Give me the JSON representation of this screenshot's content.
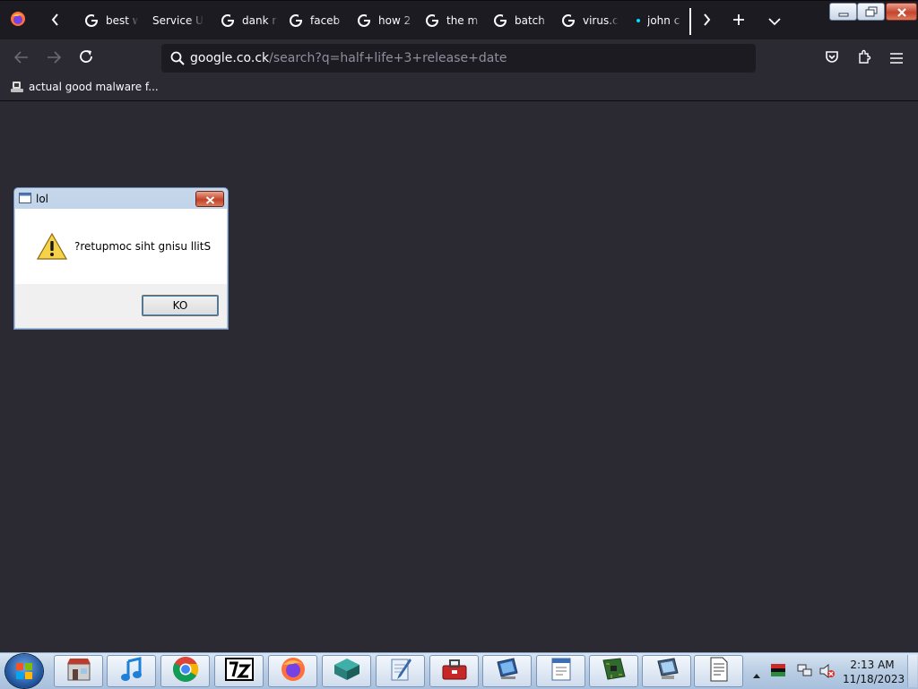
{
  "browser": {
    "tabs": [
      {
        "label": "best w",
        "icon": "google-icon"
      },
      {
        "label": "Service Un",
        "icon": "none"
      },
      {
        "label": "dank r",
        "icon": "google-icon"
      },
      {
        "label": "faceb",
        "icon": "google-icon"
      },
      {
        "label": "how 2",
        "icon": "google-icon"
      },
      {
        "label": "the m",
        "icon": "google-icon"
      },
      {
        "label": "batch",
        "icon": "google-icon"
      },
      {
        "label": "virus.c",
        "icon": "google-icon"
      },
      {
        "label": "john c",
        "icon": "loading-dot"
      }
    ],
    "url": {
      "host": "google.co.ck",
      "path": "/search?q=half+life+3+release+date"
    },
    "bookmark": {
      "label": "actual good malware f..."
    },
    "colors": {
      "toolbar": "#2b2a33",
      "tabstrip": "#1c1b22",
      "text": "#fbfbfe",
      "muted": "#8f8f9d"
    }
  },
  "dialog": {
    "title": "lol",
    "message": "?retupmoc siht gnisu llitS",
    "ok_label": "KO",
    "icon": "warning-icon"
  },
  "taskbar": {
    "apps": [
      "store-app",
      "itunes-app",
      "chrome-app",
      "7zip-app",
      "firefox-app",
      "network-app",
      "notepad-app",
      "toolbox-app",
      "computer-app",
      "wordpad-app",
      "device-manager-app",
      "my-computer-app",
      "document-app"
    ],
    "clock": {
      "time": "2:13 AM",
      "date": "11/18/2023"
    }
  }
}
